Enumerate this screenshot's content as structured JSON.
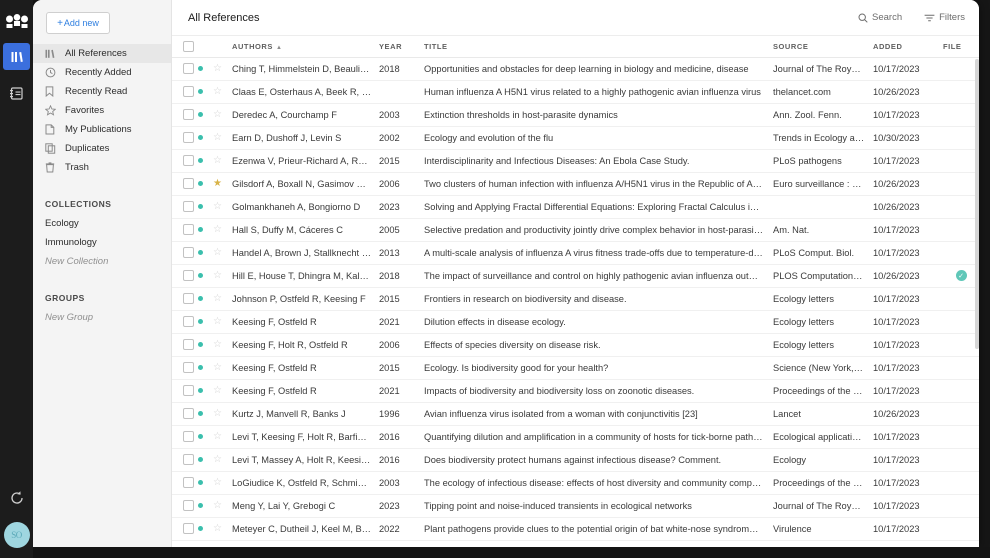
{
  "app": {
    "logo_icon": "mendeley-logo-icon",
    "rail_items": [
      {
        "name": "library-icon",
        "label": "Library",
        "active": true
      },
      {
        "name": "notebook-icon",
        "label": "Notebook",
        "active": false
      }
    ],
    "sync_icon": "sync-icon",
    "avatar_initials": "SO"
  },
  "sidebar": {
    "add_new_label": "Add new",
    "add_new_plus": "+",
    "items": [
      {
        "label": "All References",
        "icon": "library-icon",
        "active": true
      },
      {
        "label": "Recently Added",
        "icon": "clock-icon",
        "active": false
      },
      {
        "label": "Recently Read",
        "icon": "bookmark-icon",
        "active": false
      },
      {
        "label": "Favorites",
        "icon": "star-icon",
        "active": false
      },
      {
        "label": "My Publications",
        "icon": "document-icon",
        "active": false
      },
      {
        "label": "Duplicates",
        "icon": "copy-icon",
        "active": false
      },
      {
        "label": "Trash",
        "icon": "trash-icon",
        "active": false
      }
    ],
    "collections_heading": "COLLECTIONS",
    "collections": [
      {
        "label": "Ecology",
        "muted": false
      },
      {
        "label": "Immunology",
        "muted": false
      },
      {
        "label": "New Collection",
        "muted": true
      }
    ],
    "groups_heading": "GROUPS",
    "groups": [
      {
        "label": "New Group",
        "muted": true
      }
    ]
  },
  "header": {
    "title": "All References",
    "search_label": "Search",
    "search_icon": "search-icon",
    "filters_label": "Filters",
    "filters_icon": "filter-icon"
  },
  "table": {
    "columns": [
      {
        "key": "authors",
        "label": "AUTHORS",
        "sorted": true,
        "sort_caret": "▲"
      },
      {
        "key": "year",
        "label": "YEAR"
      },
      {
        "key": "title",
        "label": "TITLE"
      },
      {
        "key": "source",
        "label": "SOURCE"
      },
      {
        "key": "added",
        "label": "ADDED"
      },
      {
        "key": "file",
        "label": "FILE"
      }
    ],
    "rows": [
      {
        "authors": "Ching T, Himmelstein D, Beauli…",
        "year": "2018",
        "title": "Opportunities and obstacles for deep learning in biology and medicine, disease",
        "source": "Journal of The Royal S…",
        "added": "10/17/2023",
        "unread": true,
        "starred": false,
        "file": false
      },
      {
        "authors": "Claas E, Osterhaus A, Beek R, …",
        "year": "",
        "title": "Human influenza A H5N1 virus related to a highly pathogenic avian influenza virus",
        "source": "thelancet.com",
        "added": "10/26/2023",
        "unread": true,
        "starred": false,
        "file": false
      },
      {
        "authors": "Deredec A, Courchamp F",
        "year": "2003",
        "title": "Extinction thresholds in host-parasite dynamics",
        "source": "Ann. Zool. Fenn.",
        "added": "10/17/2023",
        "unread": true,
        "starred": false,
        "file": false
      },
      {
        "authors": "Earn D, Dushoff J, Levin S",
        "year": "2002",
        "title": "Ecology and evolution of the flu",
        "source": "Trends in Ecology and …",
        "added": "10/30/2023",
        "unread": true,
        "starred": false,
        "file": false
      },
      {
        "authors": "Ezenwa V, Prieur-Richard A, Ro…",
        "year": "2015",
        "title": "Interdisciplinarity and Infectious Diseases: An Ebola Case Study.",
        "source": "PLoS pathogens",
        "added": "10/17/2023",
        "unread": true,
        "starred": false,
        "file": false
      },
      {
        "authors": "Gilsdorf A, Boxall N, Gasimov V…",
        "year": "2006",
        "title": "Two clusters of human infection with influenza A/H5N1 virus in the Republic of Azerbaijan, Febr…",
        "source": "Euro surveillance : bull…",
        "added": "10/26/2023",
        "unread": true,
        "starred": true,
        "file": false
      },
      {
        "authors": "Golmankhaneh A, Bongiorno D",
        "year": "2023",
        "title": "Solving and Applying Fractal Differential Equations: Exploring Fractal Calculus in Theory and Pr…",
        "source": "",
        "added": "10/26/2023",
        "unread": true,
        "starred": false,
        "file": false
      },
      {
        "authors": "Hall S, Duffy M, Cáceres C",
        "year": "2005",
        "title": "Selective predation and productivity jointly drive complex behavior in host-parasite systems",
        "source": "Am. Nat.",
        "added": "10/17/2023",
        "unread": true,
        "starred": false,
        "file": false
      },
      {
        "authors": "Handel A, Brown J, Stallknecht …",
        "year": "2013",
        "title": "A multi-scale analysis of influenza A virus fitness trade-offs due to temperature-dependent virus …",
        "source": "PLoS Comput. Biol.",
        "added": "10/17/2023",
        "unread": true,
        "starred": false,
        "file": false
      },
      {
        "authors": "Hill E, House T, Dhingra M, Kal…",
        "year": "2018",
        "title": "The impact of surveillance and control on highly pathogenic avian influenza outbreaks in poultry…",
        "source": "PLOS Computational B…",
        "added": "10/26/2023",
        "unread": true,
        "starred": false,
        "file": true
      },
      {
        "authors": "Johnson P, Ostfeld R, Keesing F",
        "year": "2015",
        "title": "Frontiers in research on biodiversity and disease.",
        "source": "Ecology letters",
        "added": "10/17/2023",
        "unread": true,
        "starred": false,
        "file": false
      },
      {
        "authors": "Keesing F, Ostfeld R",
        "year": "2021",
        "title": "Dilution effects in disease ecology.",
        "source": "Ecology letters",
        "added": "10/17/2023",
        "unread": true,
        "starred": false,
        "file": false
      },
      {
        "authors": "Keesing F, Holt R, Ostfeld R",
        "year": "2006",
        "title": "Effects of species diversity on disease risk.",
        "source": "Ecology letters",
        "added": "10/17/2023",
        "unread": true,
        "starred": false,
        "file": false
      },
      {
        "authors": "Keesing F, Ostfeld R",
        "year": "2015",
        "title": "Ecology. Is biodiversity good for your health?",
        "source": "Science (New York, N.Y.)",
        "added": "10/17/2023",
        "unread": true,
        "starred": false,
        "file": false
      },
      {
        "authors": "Keesing F, Ostfeld R",
        "year": "2021",
        "title": "Impacts of biodiversity and biodiversity loss on zoonotic diseases.",
        "source": "Proceedings of the Nati…",
        "added": "10/17/2023",
        "unread": true,
        "starred": false,
        "file": false
      },
      {
        "authors": "Kurtz J, Manvell R, Banks J",
        "year": "1996",
        "title": "Avian influenza virus isolated from a woman with conjunctivitis [23]",
        "source": "Lancet",
        "added": "10/26/2023",
        "unread": true,
        "starred": false,
        "file": false
      },
      {
        "authors": "Levi T, Keesing F, Holt R, Barfie…",
        "year": "2016",
        "title": "Quantifying dilution and amplification in a community of hosts for tick-borne pathogens.",
        "source": "Ecological applications …",
        "added": "10/17/2023",
        "unread": true,
        "starred": false,
        "file": false
      },
      {
        "authors": "Levi T, Massey A, Holt R, Keesi…",
        "year": "2016",
        "title": "Does biodiversity protect humans against infectious disease? Comment.",
        "source": "Ecology",
        "added": "10/17/2023",
        "unread": true,
        "starred": false,
        "file": false
      },
      {
        "authors": "LoGiudice K, Ostfeld R, Schmid…",
        "year": "2003",
        "title": "The ecology of infectious disease: effects of host diversity and community composition on Lyme…",
        "source": "Proceedings of the Nati…",
        "added": "10/17/2023",
        "unread": true,
        "starred": false,
        "file": false
      },
      {
        "authors": "Meng Y, Lai Y, Grebogi C",
        "year": "2023",
        "title": "Tipping point and noise-induced transients in ecological networks",
        "source": "Journal of The Royal S…",
        "added": "10/17/2023",
        "unread": true,
        "starred": false,
        "file": false
      },
      {
        "authors": "Meteyer C, Dutheil J, Keel M, B…",
        "year": "2022",
        "title": "Plant pathogens provide clues to the potential origin of bat white-nose syndrome Pseudogymno…",
        "source": "Virulence",
        "added": "10/17/2023",
        "unread": true,
        "starred": false,
        "file": false
      }
    ]
  },
  "colors": {
    "accent_blue": "#3b6fdd",
    "link_blue": "#2f7fe0",
    "unread_teal": "#3bbfad",
    "file_teal": "#5fc7b8",
    "star_gold": "#d8b348",
    "avatar_blue": "#9fd6e0"
  }
}
